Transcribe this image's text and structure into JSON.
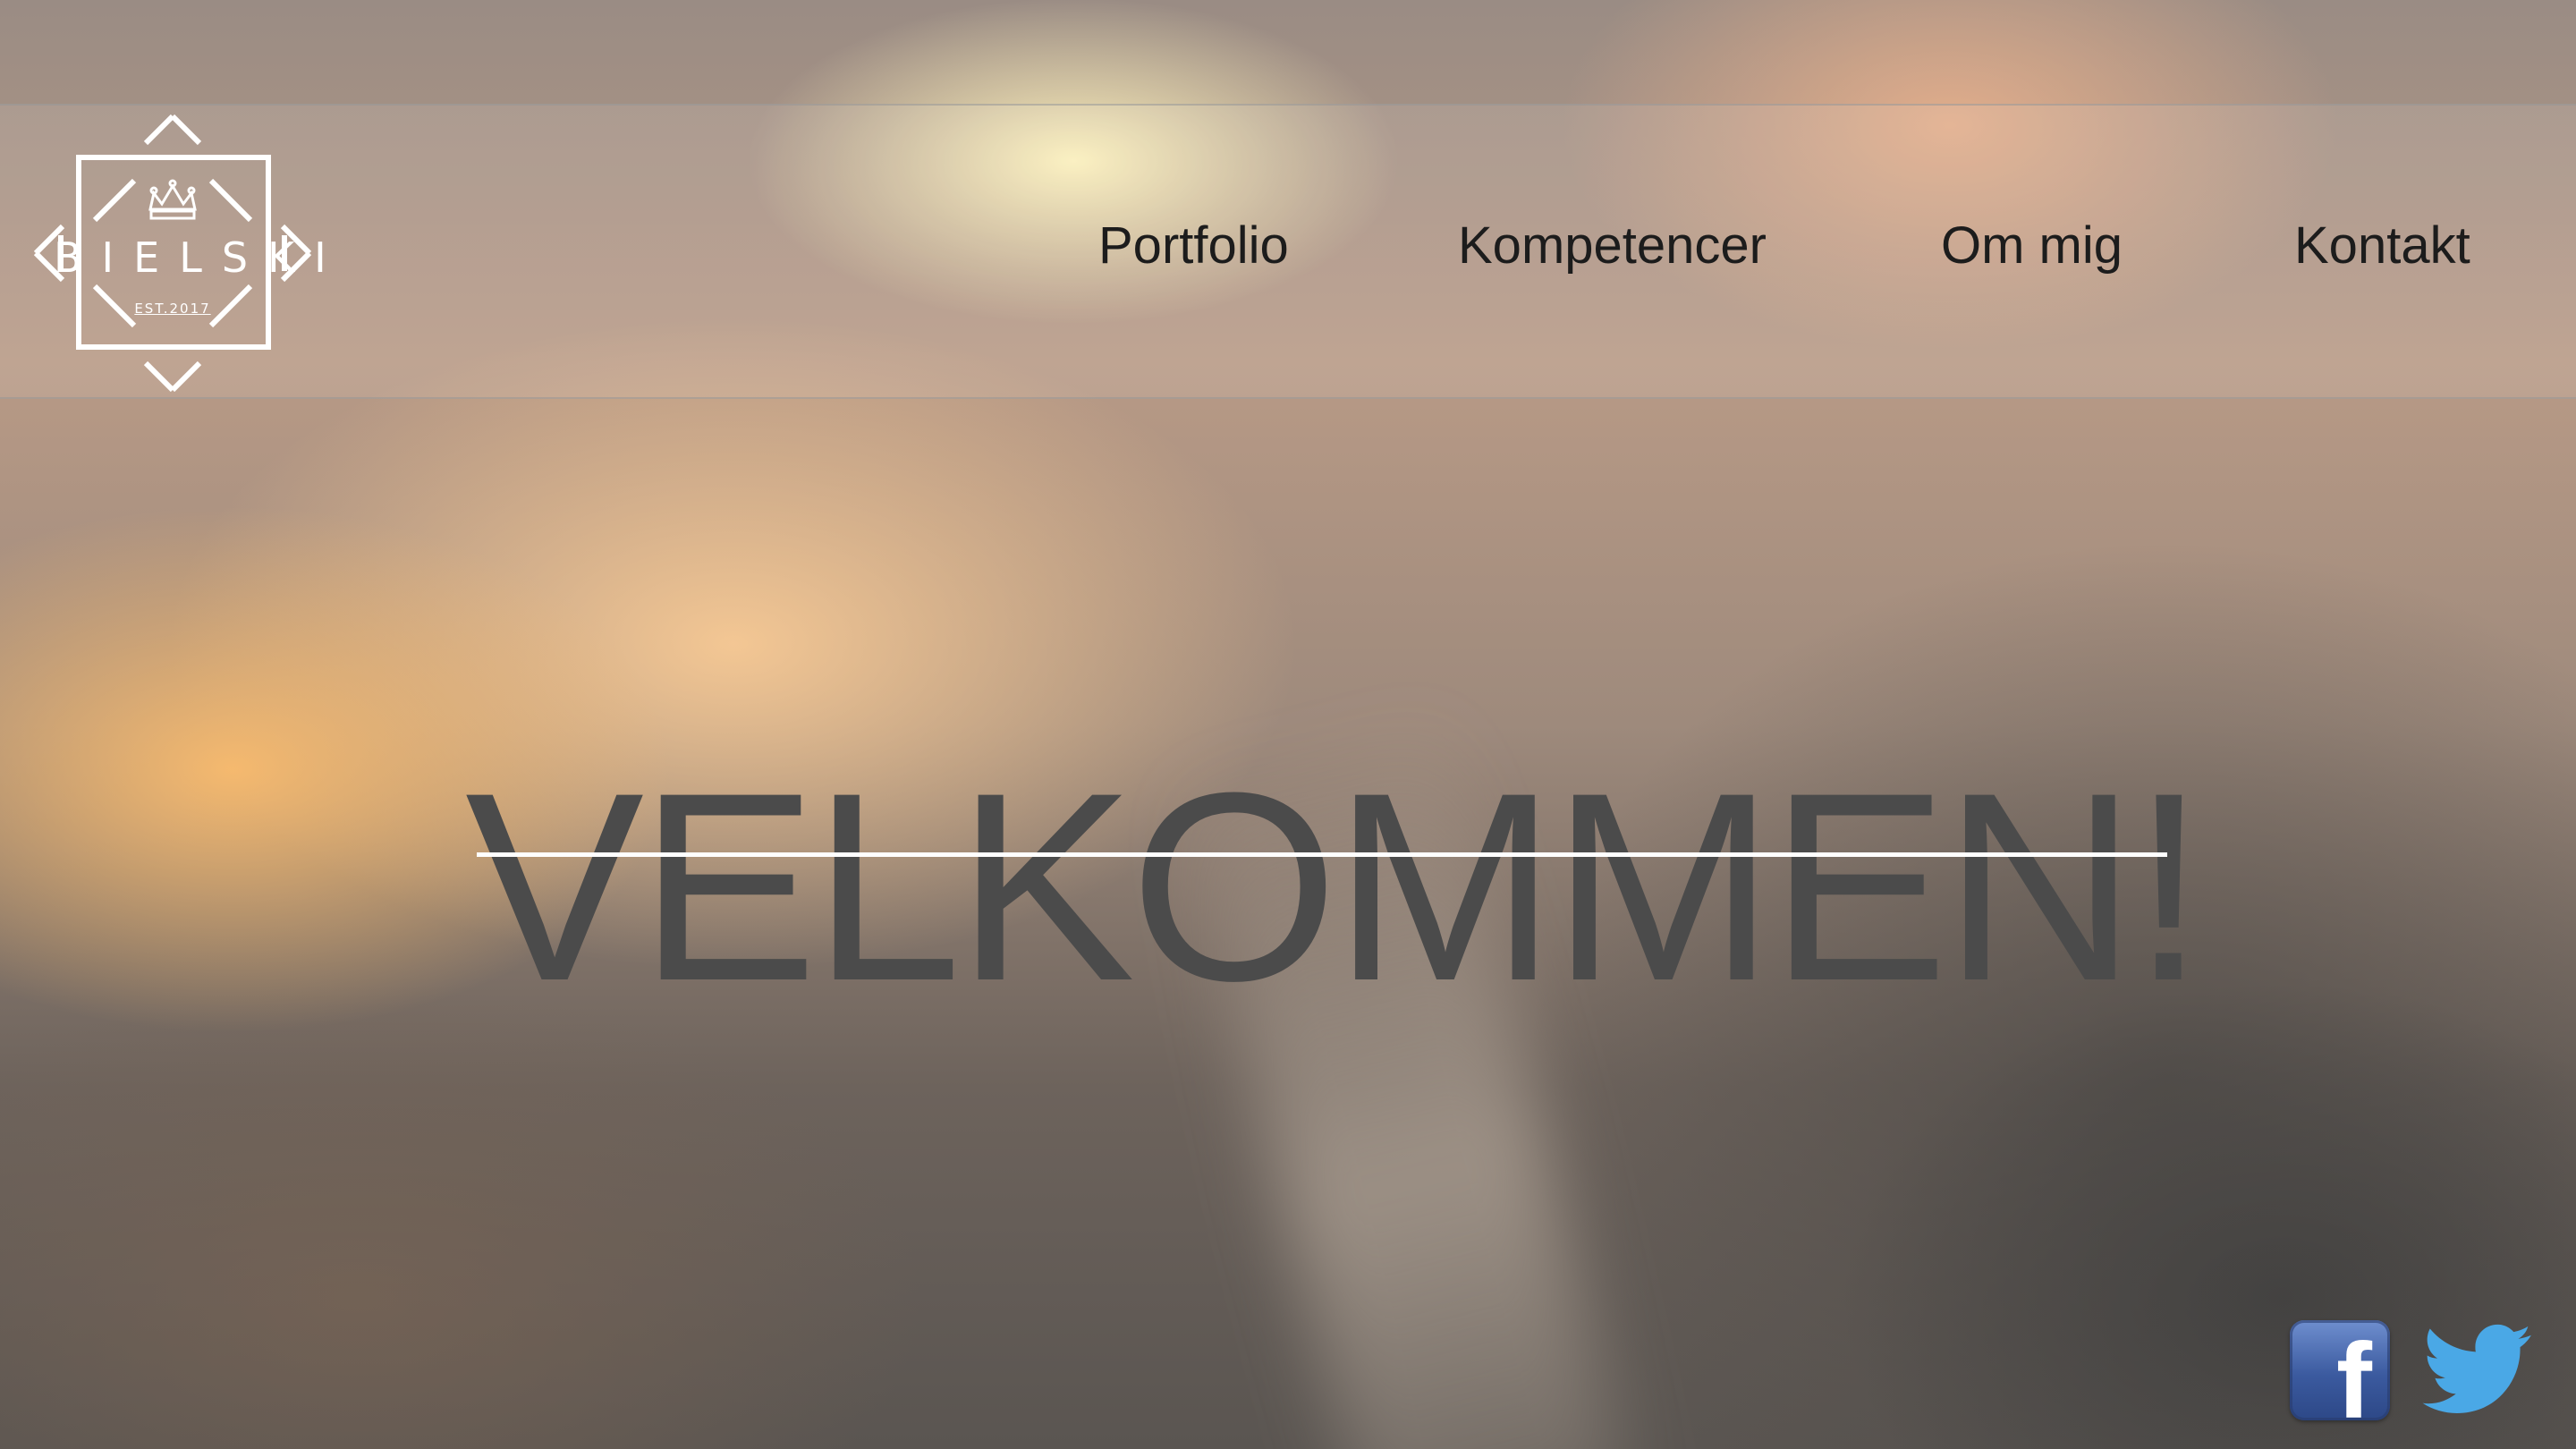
{
  "logo": {
    "name": "BIELSKI",
    "tagline": "EST.2017"
  },
  "nav": {
    "items": [
      {
        "label": "Portfolio"
      },
      {
        "label": "Kompetencer"
      },
      {
        "label": "Om mig"
      },
      {
        "label": "Kontakt"
      }
    ]
  },
  "hero": {
    "title": "VELKOMMEN!"
  },
  "social": {
    "facebook_icon": "facebook-icon",
    "twitter_icon": "twitter-icon"
  },
  "colors": {
    "hero_text": "#4b4b4b",
    "nav_text": "#1c1c1c",
    "facebook_blue": "#3b5a9f",
    "twitter_blue": "#4aa8e6"
  }
}
